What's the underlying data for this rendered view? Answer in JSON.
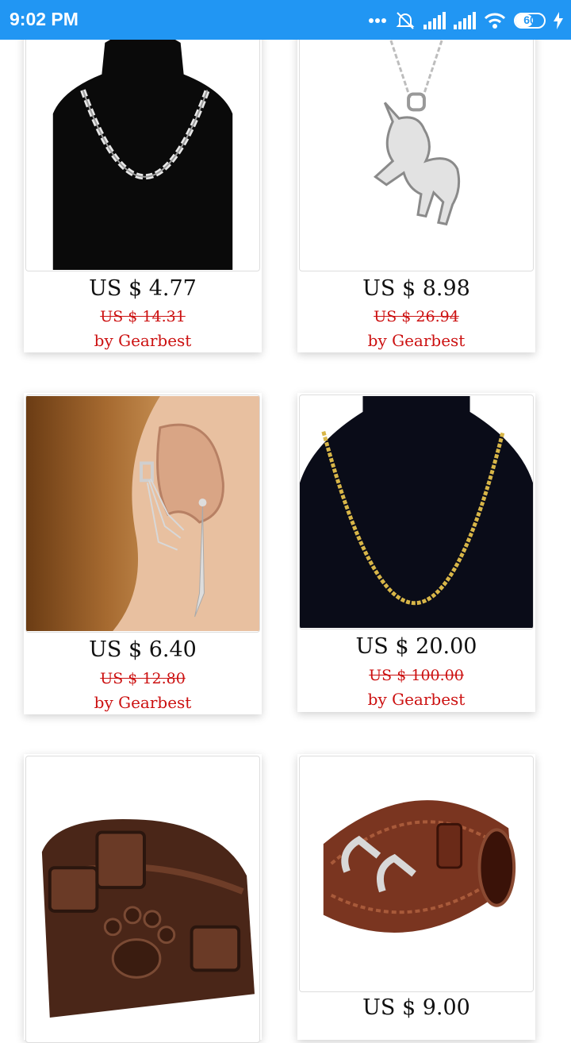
{
  "status_bar": {
    "time": "9:02 PM",
    "battery": "60"
  },
  "products": [
    {
      "price": "US $ 4.77",
      "old_price": "US $ 14.31",
      "seller": "by Gearbest",
      "image": "silver-chain-necklace"
    },
    {
      "price": "US $ 8.98",
      "old_price": "US $ 26.94",
      "seller": "by Gearbest",
      "image": "unicorn-pendant"
    },
    {
      "price": "US $ 6.40",
      "old_price": "US $ 12.80",
      "seller": "by Gearbest",
      "image": "ear-cuff-chain"
    },
    {
      "price": "US $ 20.00",
      "old_price": "US $ 100.00",
      "seller": "by Gearbest",
      "image": "gold-chain-necklace"
    },
    {
      "image": "leather-cuff-paw"
    },
    {
      "price": "US $ 9.00",
      "image": "double-buckle-leather-bracelet"
    }
  ]
}
